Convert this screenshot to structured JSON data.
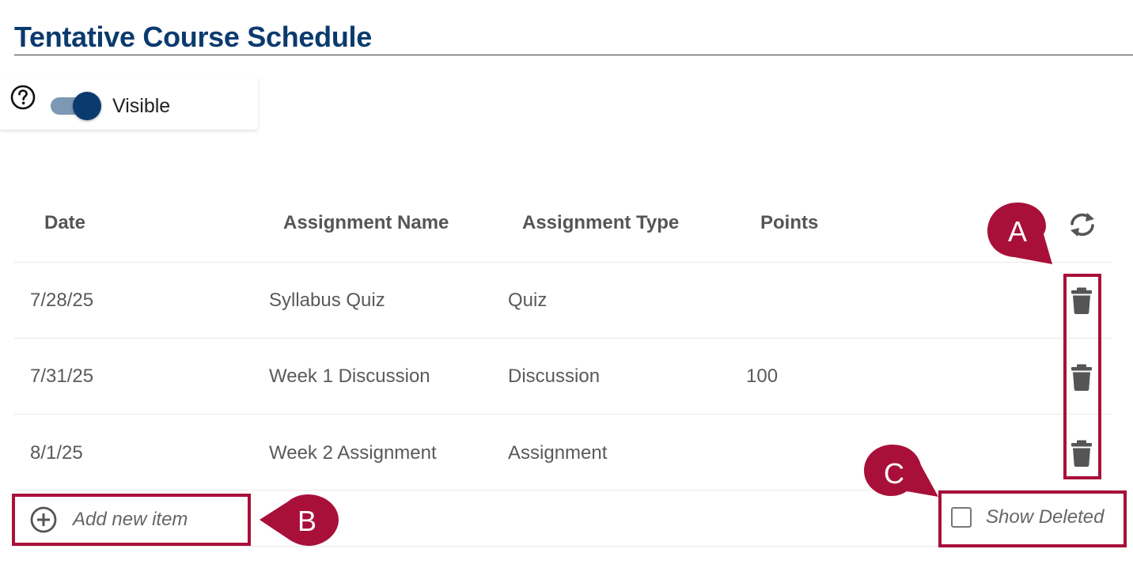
{
  "page": {
    "title": "Tentative Course Schedule"
  },
  "visibility": {
    "label": "Visible",
    "on": true
  },
  "table": {
    "headers": {
      "date": "Date",
      "name": "Assignment Name",
      "type": "Assignment Type",
      "points": "Points"
    },
    "rows": [
      {
        "date": "7/28/25",
        "name": "Syllabus Quiz",
        "type": "Quiz",
        "points": ""
      },
      {
        "date": "7/31/25",
        "name": "Week 1 Discussion",
        "type": "Discussion",
        "points": "100"
      },
      {
        "date": "8/1/25",
        "name": "Week 2 Assignment",
        "type": "Assignment",
        "points": ""
      }
    ]
  },
  "footer": {
    "add_label": "Add new item",
    "show_deleted_label": "Show Deleted",
    "show_deleted_checked": false
  },
  "callouts": {
    "a": "A",
    "b": "B",
    "c": "C"
  },
  "colors": {
    "title": "#0b3a6e",
    "accent": "#a8103a",
    "toggle_knob": "#0b3a6e",
    "toggle_track": "#7c98b5"
  },
  "icons": [
    "help-icon",
    "refresh-icon",
    "trash-icon",
    "plus-circle-icon"
  ]
}
